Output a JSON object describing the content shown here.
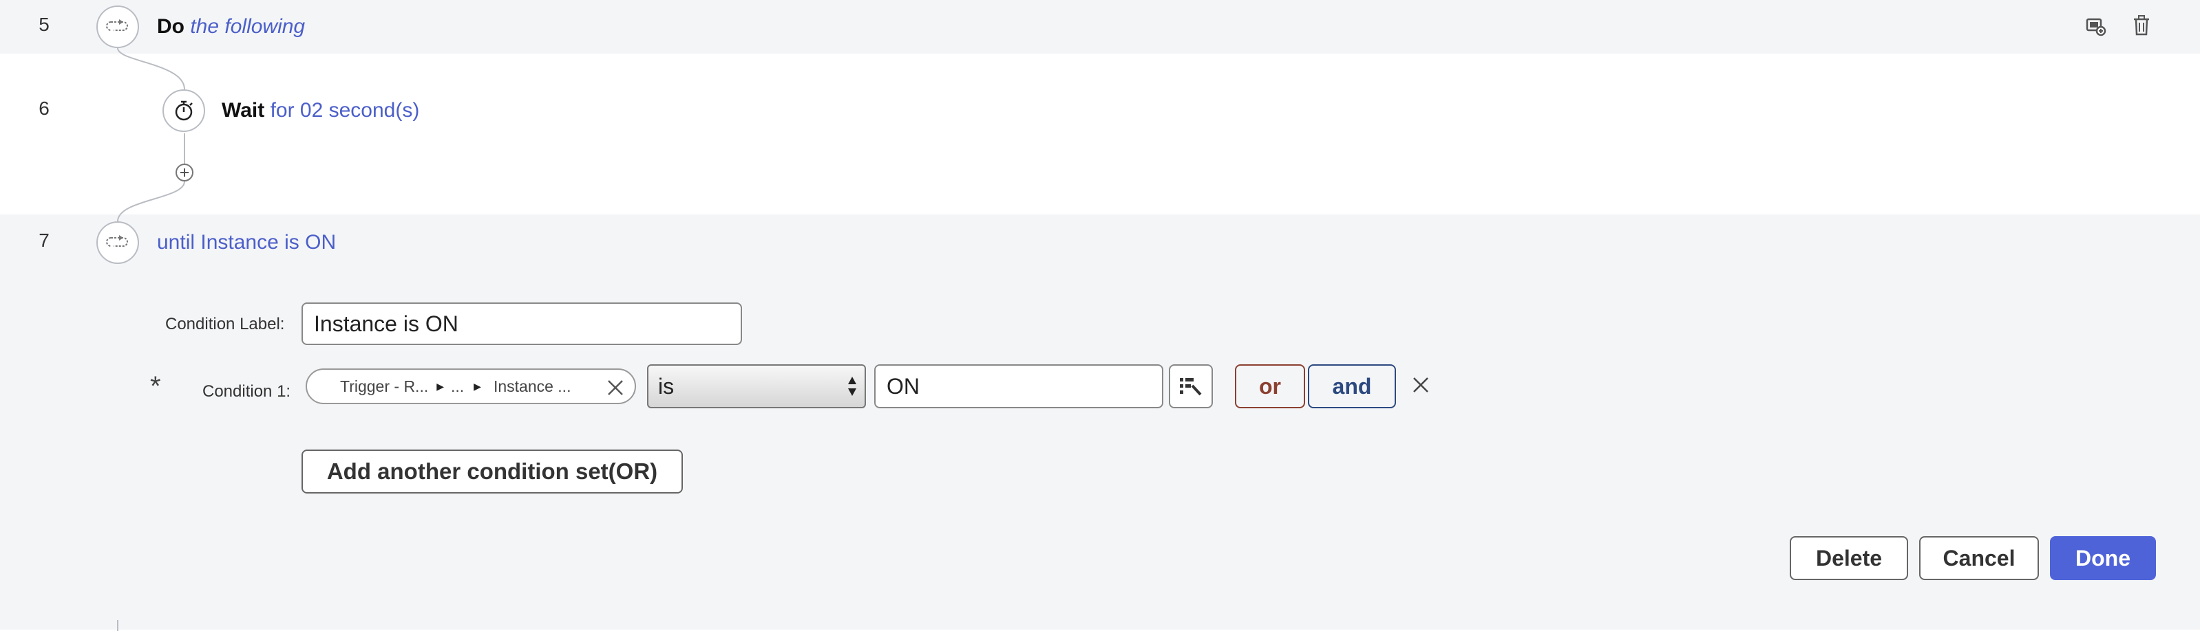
{
  "steps": [
    {
      "line": "5",
      "keyword": "Do",
      "detail": "the following",
      "icon": "loop-icon"
    },
    {
      "line": "6",
      "keyword": "Wait",
      "detail": "for 02 second(s)",
      "icon": "stopwatch-icon"
    },
    {
      "line": "7",
      "detail": "until Instance is ON",
      "icon": "loop-icon"
    }
  ],
  "toolbar": {
    "icons": [
      "duplicate-icon",
      "trash-icon"
    ]
  },
  "condition_editor": {
    "label_caption": "Condition Label:",
    "label_value": "Instance is ON",
    "required_marker": "*",
    "condition_caption": "Condition 1:",
    "path": [
      "Trigger - R...",
      "...",
      "Instance ..."
    ],
    "operator": "is",
    "value": "ON",
    "or_label": "or",
    "and_label": "and",
    "add_set_label": "Add another condition set(OR)"
  },
  "actions": {
    "delete": "Delete",
    "cancel": "Cancel",
    "done": "Done"
  },
  "colors": {
    "accent": "#4b5fc9",
    "or": "#8b4030",
    "and": "#2c4a80",
    "panel_bg": "#f4f5f7"
  }
}
